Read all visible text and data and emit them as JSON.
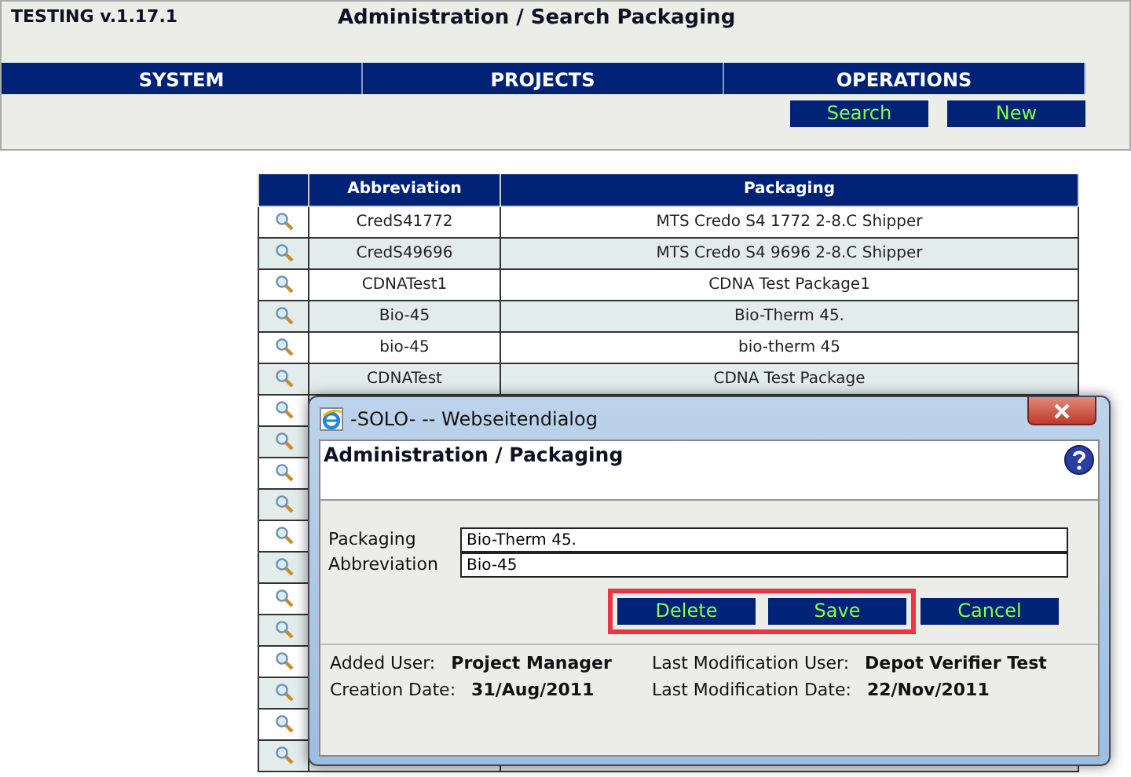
{
  "header": {
    "version": "TESTING v.1.17.1",
    "title": "Administration / Search Packaging"
  },
  "menu": [
    "SYSTEM",
    "PROJECTS",
    "OPERATIONS"
  ],
  "actions": [
    "Search",
    "New"
  ],
  "table": {
    "columns": [
      "Abbreviation",
      "Packaging"
    ],
    "rows": [
      {
        "kind": "data",
        "abbreviation": "CredS41772",
        "packaging": "MTS Credo S4 1772 2-8.C Shipper"
      },
      {
        "kind": "data",
        "abbreviation": "CredS49696",
        "packaging": "MTS Credo S4 9696 2-8.C Shipper"
      },
      {
        "kind": "data",
        "abbreviation": "CDNATest1",
        "packaging": "CDNA Test Package1"
      },
      {
        "kind": "data",
        "abbreviation": "Bio-45",
        "packaging": "Bio-Therm 45."
      },
      {
        "kind": "data",
        "abbreviation": "bio-45",
        "packaging": "bio-therm 45"
      },
      {
        "kind": "data",
        "abbreviation": "CDNATest",
        "packaging": "CDNA Test Package"
      },
      {
        "kind": "covered"
      },
      {
        "kind": "covered"
      },
      {
        "kind": "covered"
      },
      {
        "kind": "covered"
      },
      {
        "kind": "covered"
      },
      {
        "kind": "covered"
      },
      {
        "kind": "covered"
      },
      {
        "kind": "covered"
      },
      {
        "kind": "covered"
      },
      {
        "kind": "covered"
      },
      {
        "kind": "covered"
      },
      {
        "kind": "covered"
      }
    ]
  },
  "dialog": {
    "window_title": "-SOLO- -- Webseitendialog",
    "title": "Administration / Packaging",
    "fields": [
      {
        "label": "Packaging",
        "value": "Bio-Therm 45."
      },
      {
        "label": "Abbreviation",
        "value": "Bio-45"
      }
    ],
    "highlighted_buttons": [
      "Delete",
      "Save"
    ],
    "buttons": [
      "Cancel"
    ],
    "info": [
      {
        "label": "Added User:",
        "value": "Project Manager"
      },
      {
        "label": "Last Modification User:",
        "value": "Depot Verifier Test"
      },
      {
        "label": "Creation Date:",
        "value": "31/Aug/2011"
      },
      {
        "label": "Last Modification Date:",
        "value": "22/Nov/2011"
      }
    ]
  }
}
